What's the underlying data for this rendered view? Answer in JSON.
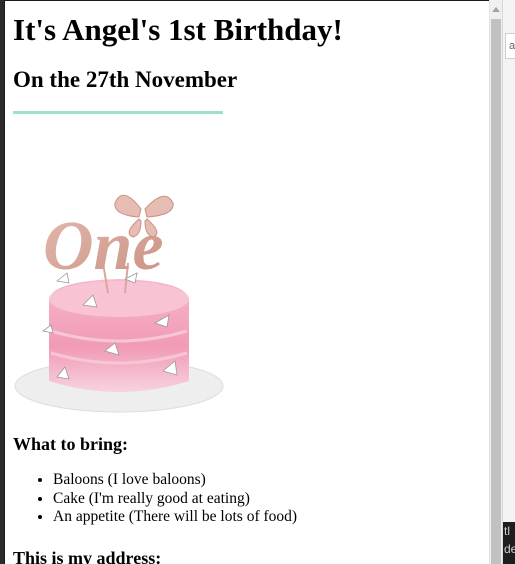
{
  "background_window": {
    "input_fragment": "arc",
    "dark_fragment": "tl de"
  },
  "page": {
    "title": "It's Angel's 1st Birthday!",
    "date_heading": "On the 27th November",
    "divider_color": "#9fdfd2",
    "cake_image": {
      "topper_text": "One",
      "description": "cake-image"
    },
    "bring_heading": "What to bring:",
    "bring_items": [
      "Baloons (I love baloons)",
      "Cake (I'm really good at eating)",
      "An appetite (There will be lots of food)"
    ],
    "address_heading": "This is my address:"
  },
  "colors": {
    "accent_divider": "#9fdfd2",
    "cake_pink": "#f3a9c0",
    "topper_rose_gold": "#d9a79c",
    "scrollbar_thumb": "#c1c1c1"
  }
}
